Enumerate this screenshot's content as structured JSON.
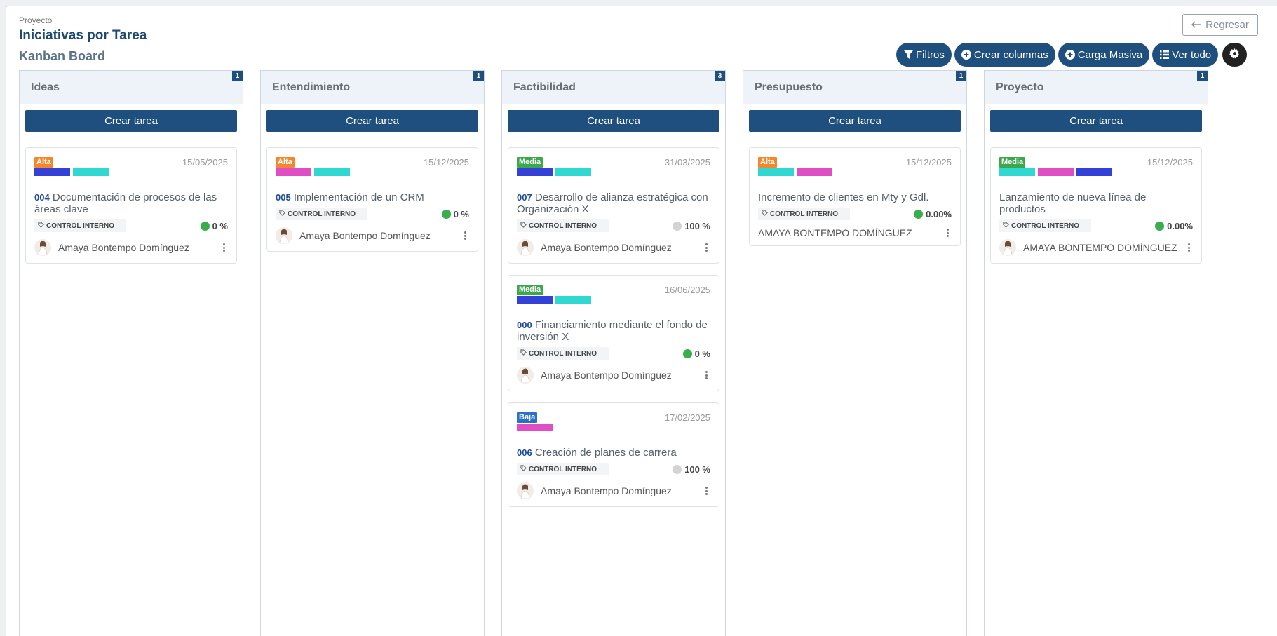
{
  "header": {
    "crumb": "Proyecto",
    "title": "Iniciativas por Tarea",
    "subtitle": "Kanban Board",
    "back_label": "Regresar"
  },
  "toolbar": {
    "filters": "Filtros",
    "create_columns": "Crear columnas",
    "bulk_load": "Carga Masiva",
    "view_all": "Ver todo"
  },
  "colors": {
    "primary": "#1f4f7c",
    "alta": "#f5862b",
    "media": "#3aa84b",
    "baja": "#2a6fc9",
    "tag_blue": "#3341d6",
    "tag_cyan": "#2fd8d0",
    "tag_pink": "#e04ec5",
    "progress_green": "#3aae4d",
    "progress_grey": "#d3d3d3"
  },
  "create_task_label": "Crear tarea",
  "columns": [
    {
      "name": "Ideas",
      "count": "1",
      "cards": [
        {
          "priority": "Alta",
          "prio_color": "#f5862b",
          "date": "15/05/2025",
          "tags": [
            "#3341d6",
            "#2fd8d0"
          ],
          "num": "004",
          "title": "Documentación de procesos de las áreas clave",
          "label": "CONTROL INTERNO",
          "progress": "0 %",
          "progress_color": "#3aae4d",
          "owner": "Amaya Bontempo Domínguez"
        }
      ]
    },
    {
      "name": "Entendimiento",
      "count": "1",
      "cards": [
        {
          "priority": "Alta",
          "prio_color": "#f5862b",
          "date": "15/12/2025",
          "tags": [
            "#e04ec5",
            "#2fd8d0"
          ],
          "num": "005",
          "title": "Implementación de un CRM",
          "label": "CONTROL INTERNO",
          "progress": "0 %",
          "progress_color": "#3aae4d",
          "owner": "Amaya Bontempo Domínguez"
        }
      ]
    },
    {
      "name": "Factibilidad",
      "count": "3",
      "cards": [
        {
          "priority": "Media",
          "prio_color": "#3aa84b",
          "date": "31/03/2025",
          "tags": [
            "#3341d6",
            "#2fd8d0"
          ],
          "num": "007",
          "title": "Desarrollo de alianza estratégica con Organización X",
          "label": "CONTROL INTERNO",
          "progress": "100 %",
          "progress_color": "#d3d3d3",
          "owner": "Amaya Bontempo Domínguez"
        },
        {
          "priority": "Media",
          "prio_color": "#3aa84b",
          "date": "16/06/2025",
          "tags": [
            "#3341d6",
            "#2fd8d0"
          ],
          "num": "000",
          "title": "Financiamiento mediante el fondo de inversión X",
          "label": "CONTROL INTERNO",
          "progress": "0 %",
          "progress_color": "#3aae4d",
          "owner": "Amaya Bontempo Domínguez"
        },
        {
          "priority": "Baja",
          "prio_color": "#2a6fc9",
          "date": "17/02/2025",
          "tags": [
            "#e04ec5"
          ],
          "num": "006",
          "title": "Creación de planes de carrera",
          "label": "CONTROL INTERNO",
          "progress": "100 %",
          "progress_color": "#d3d3d3",
          "owner": "Amaya Bontempo Domínguez"
        }
      ]
    },
    {
      "name": "Presupuesto",
      "count": "1",
      "cards": [
        {
          "priority": "Alta",
          "prio_color": "#f5862b",
          "date": "15/12/2025",
          "tags": [
            "#2fd8d0",
            "#e04ec5"
          ],
          "num": "",
          "title": "Incremento de clientes en Mty y Gdl.",
          "label": "CONTROL INTERNO",
          "progress": "0.00%",
          "progress_color": "#3aae4d",
          "owner": "AMAYA BONTEMPO DOMÍNGUEZ",
          "no_avatar": true
        }
      ]
    },
    {
      "name": "Proyecto",
      "count": "1",
      "cards": [
        {
          "priority": "Media",
          "prio_color": "#3aa84b",
          "date": "15/12/2025",
          "tags": [
            "#2fd8d0",
            "#e04ec5",
            "#3341d6"
          ],
          "num": "",
          "title": "Lanzamiento de nueva línea de productos",
          "label": "CONTROL INTERNO",
          "progress": "0.00%",
          "progress_color": "#3aae4d",
          "owner": "AMAYA BONTEMPO DOMÍNGUEZ"
        }
      ]
    }
  ]
}
